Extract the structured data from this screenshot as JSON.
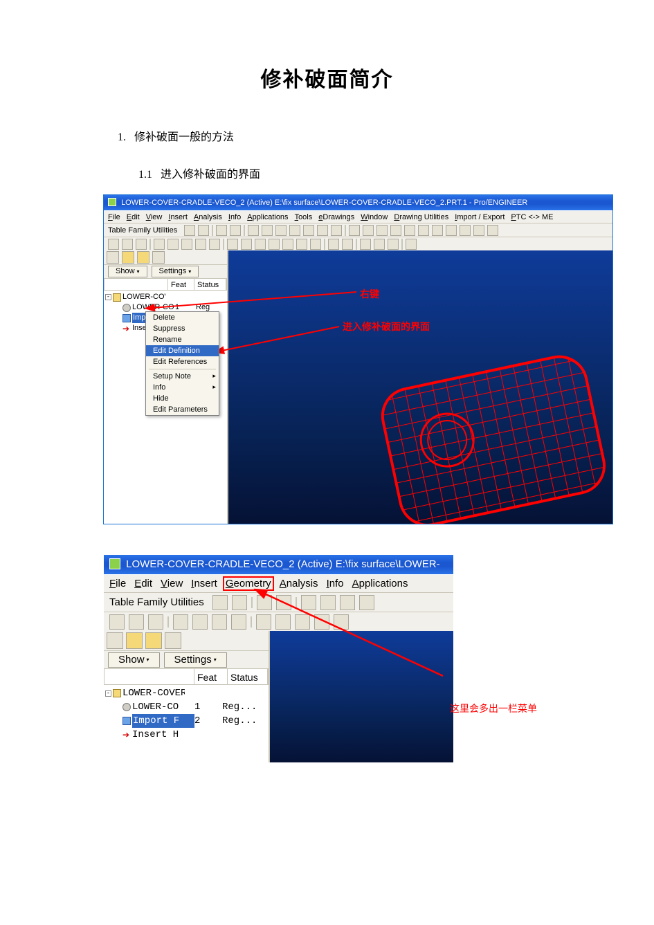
{
  "doc": {
    "title": "修补破面简介",
    "h1_num": "1.",
    "h1": "修补破面一般的方法",
    "h2_num": "1.1",
    "h2": "进入修补破面的界面"
  },
  "shot1": {
    "title": "LOWER-COVER-CRADLE-VECO_2 (Active) E:\\fix surface\\LOWER-COVER-CRADLE-VECO_2.PRT.1 - Pro/ENGINEER",
    "menus": [
      "File",
      "Edit",
      "View",
      "Insert",
      "Analysis",
      "Info",
      "Applications",
      "Tools",
      "eDrawings",
      "Window",
      "Drawing Utilities",
      "Import / Export",
      "PTC <-> ME"
    ],
    "toolbar1_label": "Table Family Utilities",
    "show": "Show",
    "settings": "Settings",
    "tree_cols": [
      "",
      "Feat #",
      "Status"
    ],
    "tree": [
      {
        "name": "LOWER-COVER-",
        "icon": "folder",
        "indent": 0,
        "pm": "-"
      },
      {
        "name": "LOWER-CO",
        "icon": "gear",
        "indent": 1,
        "feat": "1",
        "status": "Reg"
      },
      {
        "name": "Impo",
        "icon": "imp",
        "indent": 1,
        "sel": true,
        "feat": "",
        "status": ""
      },
      {
        "name": "Inser",
        "icon": "arrow",
        "indent": 1,
        "feat": "",
        "status": ""
      }
    ],
    "context_menu": [
      "Delete",
      "Suppress",
      "Rename",
      "Edit Definition",
      "Edit References",
      "—",
      "Setup Note",
      "Info",
      "Hide",
      "Edit Parameters"
    ],
    "context_selected": "Edit Definition",
    "context_sub": [
      "Setup Note",
      "Info"
    ],
    "anno1": "右键",
    "anno2": "进入修补破面的界面"
  },
  "shot2": {
    "title": "LOWER-COVER-CRADLE-VECO_2 (Active) E:\\fix surface\\LOWER-",
    "menus": [
      "File",
      "Edit",
      "View",
      "Insert",
      "Geometry",
      "Analysis",
      "Info",
      "Applications"
    ],
    "boxed_menu": "Geometry",
    "toolbar1_label": "Table Family Utilities",
    "show": "Show",
    "settings": "Settings",
    "tree_cols": [
      "",
      "Feat #",
      "Status"
    ],
    "tree": [
      {
        "name": "LOWER-COVER-",
        "icon": "folder",
        "indent": 0,
        "pm": "-"
      },
      {
        "name": "LOWER-CO",
        "icon": "gear",
        "indent": 1,
        "feat": "1",
        "status": "Reg..."
      },
      {
        "name": "Import F",
        "icon": "imp",
        "indent": 1,
        "sel": true,
        "feat": "2",
        "status": "Reg..."
      },
      {
        "name": "Insert H",
        "icon": "arrow",
        "indent": 1,
        "feat": "",
        "status": ""
      }
    ],
    "anno": "这里会多出一栏菜单"
  }
}
